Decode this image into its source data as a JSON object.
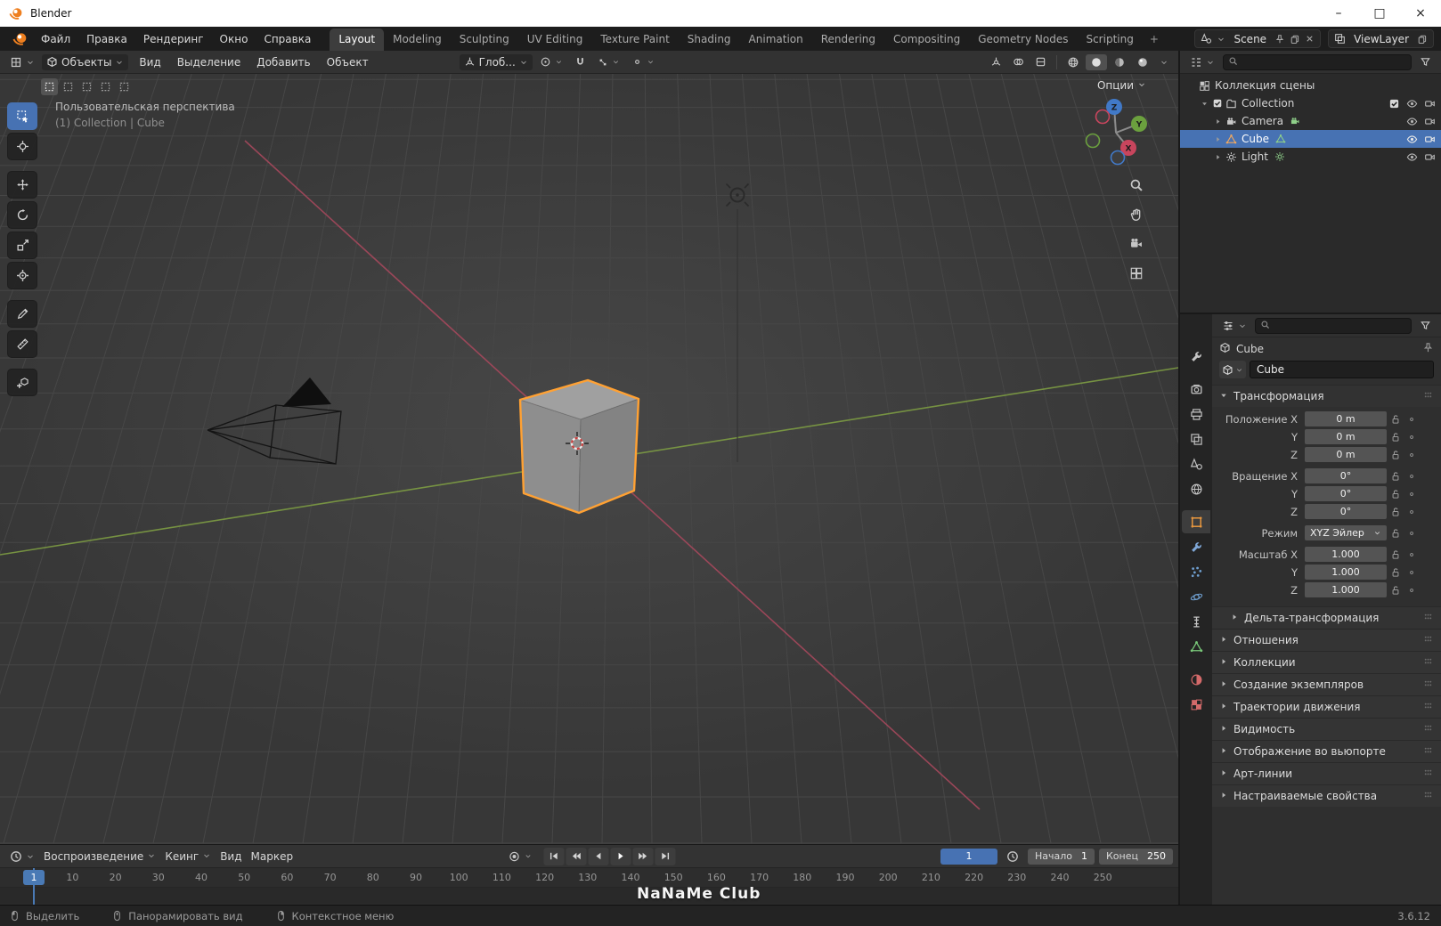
{
  "titlebar": {
    "app_title": "Blender",
    "window_controls": {
      "minimize": "–",
      "maximize": "□",
      "close": "×"
    }
  },
  "topbar": {
    "menus": [
      "Файл",
      "Правка",
      "Рендеринг",
      "Окно",
      "Справка"
    ],
    "workspaces": [
      "Layout",
      "Modeling",
      "Sculpting",
      "UV Editing",
      "Texture Paint",
      "Shading",
      "Animation",
      "Rendering",
      "Compositing",
      "Geometry Nodes",
      "Scripting"
    ],
    "active_workspace": "Layout",
    "add_workspace": "+",
    "scene_selector": {
      "label": "Scene"
    },
    "viewlayer_selector": {
      "label": "ViewLayer"
    }
  },
  "viewport_header": {
    "mode_selector": "Объекты",
    "menus": [
      "Вид",
      "Выделение",
      "Добавить",
      "Объект"
    ],
    "orientation": "Глоб...",
    "options_button": "Опции"
  },
  "viewport": {
    "overlay": {
      "line1": "Пользовательская перспектива",
      "line2": "(1) Collection | Cube"
    },
    "gizmo_axes": {
      "x": "X",
      "y": "Y",
      "z": "Z"
    },
    "tools": [
      "select-box",
      "cursor",
      "move",
      "rotate",
      "scale",
      "transform",
      "annotate",
      "measure",
      "add-cube"
    ],
    "active_tool": "select-box",
    "select_tool_modes": [
      "new",
      "extend",
      "subtract",
      "invert",
      "intersect"
    ],
    "nav_buttons": [
      "zoom",
      "pan",
      "camera-view",
      "toggle-ortho"
    ]
  },
  "outliner": {
    "search_placeholder": "",
    "rows": [
      {
        "label": "Коллекция сцены",
        "icon": "scene-collection",
        "level": 0,
        "right_icons": []
      },
      {
        "label": "Collection",
        "icon": "collection",
        "level": 1,
        "arrow": "down",
        "checkbox": true,
        "right_icons": [
          "filter-check",
          "eye",
          "camera-restrict"
        ]
      },
      {
        "label": "Camera",
        "icon": "camera-object",
        "badge": "camera-data",
        "level": 2,
        "arrow": "right",
        "right_icons": [
          "eye",
          "camera-restrict"
        ]
      },
      {
        "label": "Cube",
        "icon": "mesh-object",
        "badge": "mesh-data",
        "level": 2,
        "arrow": "right",
        "selected": true,
        "right_icons": [
          "eye",
          "camera-restrict"
        ]
      },
      {
        "label": "Light",
        "icon": "light-object",
        "badge": "light-data",
        "level": 2,
        "arrow": "right",
        "right_icons": [
          "eye",
          "camera-restrict"
        ]
      }
    ]
  },
  "properties": {
    "search_placeholder": "",
    "breadcrumb": {
      "object": "Cube"
    },
    "name_field": "Cube",
    "tabs": [
      "tool",
      "render",
      "output",
      "view-layer",
      "scene",
      "world",
      "object",
      "modifiers",
      "particles",
      "physics",
      "constraints",
      "object-data",
      "material",
      "texture"
    ],
    "active_tab": "object",
    "transform": {
      "section_label": "Трансформация",
      "groups": [
        {
          "rows": [
            {
              "label": "Положение X",
              "value": "0 m"
            },
            {
              "label": "Y",
              "value": "0 m"
            },
            {
              "label": "Z",
              "value": "0 m"
            }
          ]
        },
        {
          "rows": [
            {
              "label": "Вращение X",
              "value": "0°"
            },
            {
              "label": "Y",
              "value": "0°"
            },
            {
              "label": "Z",
              "value": "0°"
            }
          ]
        },
        {
          "rows": [
            {
              "label": "Режим",
              "value": "XYZ Эйлер",
              "type": "dropdown"
            }
          ]
        },
        {
          "rows": [
            {
              "label": "Масштаб X",
              "value": "1.000"
            },
            {
              "label": "Y",
              "value": "1.000"
            },
            {
              "label": "Z",
              "value": "1.000"
            }
          ]
        }
      ]
    },
    "collapsed_sections": [
      "Дельта-трансформация",
      "Отношения",
      "Коллекции",
      "Создание экземпляров",
      "Траектории движения",
      "Видимость",
      "Отображение во вьюпорте",
      "Арт-линии",
      "Настраиваемые свойства"
    ]
  },
  "timeline": {
    "menus": {
      "playback": "Воспроизведение",
      "keying": "Кеинг",
      "view": "Вид",
      "marker": "Маркер"
    },
    "transport": [
      "jump-start",
      "prev-keyframe",
      "prev-frame",
      "play",
      "next-keyframe",
      "jump-end"
    ],
    "current_frame": "1",
    "start": {
      "label": "Начало",
      "value": "1"
    },
    "end": {
      "label": "Конец",
      "value": "250"
    },
    "playhead_frame": "1",
    "ruler_marks": [
      "10",
      "20",
      "30",
      "40",
      "50",
      "60",
      "70",
      "80",
      "90",
      "100",
      "110",
      "120",
      "130",
      "140",
      "150",
      "160",
      "170",
      "180",
      "190",
      "200",
      "210",
      "220",
      "230",
      "240",
      "250"
    ]
  },
  "statusbar": {
    "hints": [
      {
        "icon": "mouse-left",
        "label": "Выделить"
      },
      {
        "icon": "mouse-middle",
        "label": "Панорамировать вид"
      },
      {
        "icon": "mouse-right",
        "label": "Контекстное меню"
      }
    ],
    "watermark": "NaNaMe Club",
    "version": "3.6.12"
  },
  "colors": {
    "selection_blue": "#4772b3",
    "object_orange": "#ffa133",
    "axis_green": "#7d9c43",
    "axis_red": "#a5485c"
  }
}
